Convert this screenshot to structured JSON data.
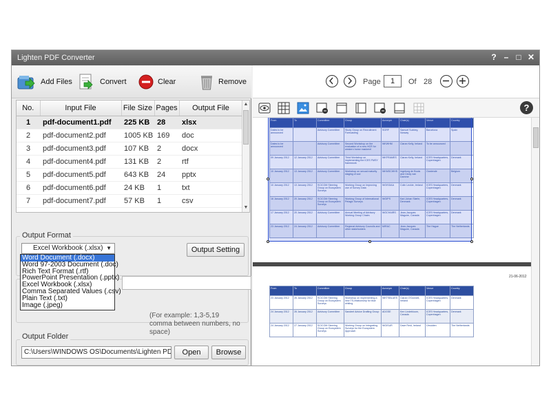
{
  "app": {
    "title": "Lighten PDF Converter",
    "controls": [
      "?",
      "–",
      "□",
      "✕"
    ]
  },
  "toolbar": {
    "add_files": "Add Files",
    "convert": "Convert",
    "clear": "Clear",
    "remove": "Remove"
  },
  "table": {
    "headers": [
      "No.",
      "Input File",
      "File Size",
      "Pages",
      "Output File"
    ],
    "rows": [
      {
        "no": "1",
        "file": "pdf-document1.pdf",
        "size": "225 KB",
        "pages": "28",
        "out": "xlsx"
      },
      {
        "no": "2",
        "file": "pdf-document2.pdf",
        "size": "1005 KB",
        "pages": "169",
        "out": "doc"
      },
      {
        "no": "3",
        "file": "pdf-document3.pdf",
        "size": "107 KB",
        "pages": "2",
        "out": "docx"
      },
      {
        "no": "4",
        "file": "pdf-document4.pdf",
        "size": "131 KB",
        "pages": "2",
        "out": "rtf"
      },
      {
        "no": "5",
        "file": "pdf-document5.pdf",
        "size": "643 KB",
        "pages": "24",
        "out": "pptx"
      },
      {
        "no": "6",
        "file": "pdf-document6.pdf",
        "size": "24 KB",
        "pages": "1",
        "out": "txt"
      },
      {
        "no": "7",
        "file": "pdf-document7.pdf",
        "size": "57 KB",
        "pages": "1",
        "out": "csv"
      }
    ]
  },
  "output_format": {
    "label": "Output Format",
    "selected": "Excel Workbook (.xlsx)",
    "options": [
      "Word Document (.docx)",
      "Word 97-2003 Document (.doc)",
      "Rich Text Format (.rtf)",
      "PowerPoint Presentation (.pptx)",
      "Excel Workbook (.xlsx)",
      "Comma Separated Values (.csv)",
      "Plain Text (.txt)",
      "Image (.jpeg)"
    ],
    "setting_button": "Output Setting"
  },
  "page_range": {
    "hint_line1": "(For example: 1,3-5,19",
    "hint_line2": "comma between numbers, no space)"
  },
  "output_folder": {
    "label": "Output Folder",
    "path": "C:\\Users\\WINDOWS OS\\Documents\\Lighten PDF Converter",
    "open": "Open",
    "browse": "Browse"
  },
  "viewer": {
    "page_label": "Page",
    "current_page": "1",
    "of_label": "Of",
    "total_pages": "28",
    "help": "?"
  },
  "preview": {
    "header": [
      "From",
      "To",
      "Committee",
      "Group",
      "Acronym",
      "Chair(s)",
      "Venue",
      "Country"
    ],
    "rows": [
      [
        "Dates to be announced",
        "",
        "Advisory Committee",
        "Study Group on Recruitment Forecasting",
        "SGRF",
        "Samuel Subbey, Norway",
        "Barcelona",
        "Spain"
      ],
      [
        "Dates to be announced",
        "",
        "Advisory Committee",
        "Second Workshop on the evaluation of a new HCR for western horse mackerel",
        "WKWHM",
        "Ciaran Kelly, Ireland",
        "To be announced",
        ""
      ],
      [
        "09 January 2012",
        "12 January 2012",
        "Advisory Committee",
        "Third Workshop on implementing the ICES FMSY framework",
        "WKFRAMES",
        "Ciaran Kelly, Ireland",
        "ICES Headquarters, Copenhagen",
        "Denmark"
      ],
      [
        "10 January 2012",
        "13 January 2012",
        "Advisory Committee",
        "Workshop on sexual maturity staging of cod",
        "WKMSCWHS",
        "Ingeborg de Boois and Cindy van Damme",
        "Oostende",
        "Belgium"
      ],
      [
        "10 January 2012",
        "13 January 2012",
        "SCICOM Steering Group on Ecosystem Surveys",
        "Working Group on Improving use of Survey Data",
        "WGISDAA",
        "Colin Leckie, Ireland",
        "ICES Headquarters, Copenhagen",
        "Denmark"
      ],
      [
        "16 January 2012",
        "20 January 2012",
        "SCICOM Steering Group on Ecosystem Surveys",
        "Working Group of International Pelagic Surveys",
        "WGIPS",
        "Karl-Johan Stæhr, Denmark",
        "ICES Headquarters, Copenhagen",
        "Denmark"
      ],
      [
        "17 January 2012",
        "20 January 2012",
        "Advisory Committee",
        "Annual Meeting of Advisory Working Group Chairs",
        "WGCHAIRS",
        "Jean-Jacques Maguire, Canada",
        "ICES Headquarters, Copenhagen",
        "Denmark"
      ],
      [
        "23 January 2012",
        "24 January 2012",
        "Advisory Committee",
        "Regional Advisory Councils and other stakeholders",
        "MIRAC",
        "Jean-Jacques Maguire, Canada",
        "The Hague",
        "The Netherlands"
      ]
    ],
    "page2_date": "21-06-2012",
    "page2_rows": [
      [
        "23 January 2012",
        "26 January 2012",
        "SCICOM Steering Group on Ecosystem Surveys",
        "Workshop on implementing a new TS-relationship for blue whiting",
        "WKTSBLUES",
        "Ciaran O'Donnell, Ireland",
        "ICES Headquarters, Copenhagen",
        "Denmark"
      ],
      [
        "24 January 2012",
        "26 January 2012",
        "Advisory Committee",
        "Sandeel Advice Drafting Group",
        "ADGSE",
        "Ken Lindebloom, Canada",
        "ICES Headquarters, Copenhagen",
        "Denmark"
      ],
      [
        "24 January 2012",
        "27 January 2012",
        "SCICOM Steering Group on Ecosystem Surveys",
        "Working Group on Integrating Surveys for the Ecosystem Approach",
        "WGISUR",
        "Dave Reid, Ireland",
        "IJmuiden",
        "The Netherlands"
      ]
    ]
  }
}
